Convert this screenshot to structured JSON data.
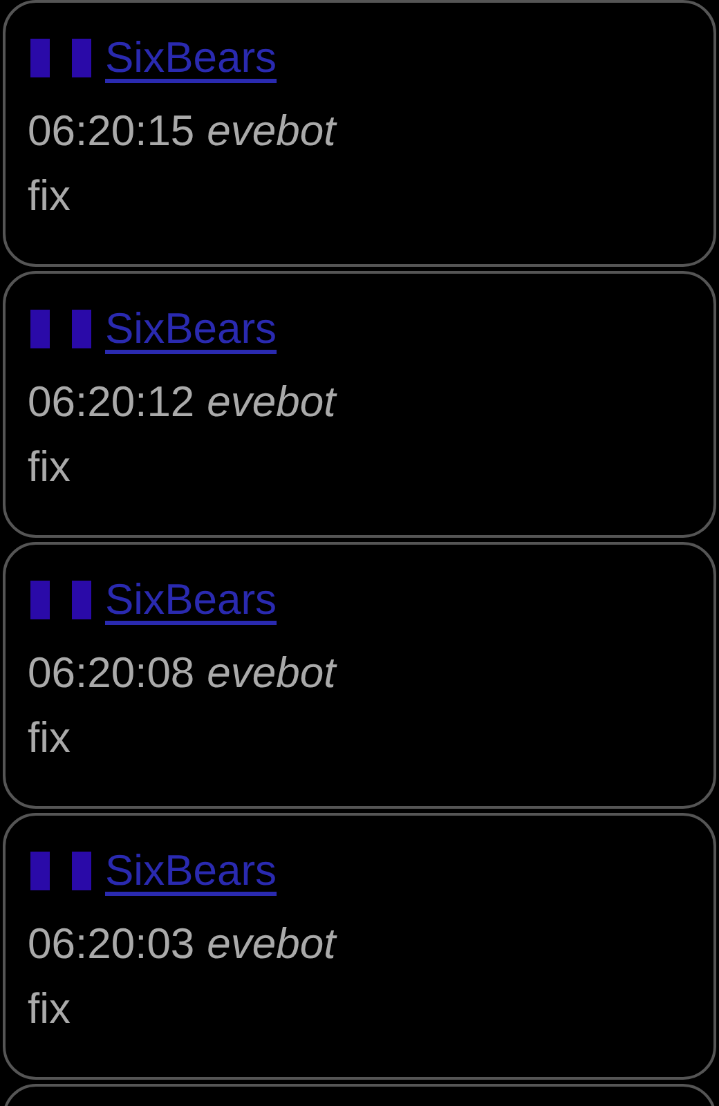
{
  "messages": [
    {
      "author": "SixBears",
      "time": "06:20:15",
      "bot": "evebot",
      "text": "fix"
    },
    {
      "author": "SixBears",
      "time": "06:20:12",
      "bot": "evebot",
      "text": "fix"
    },
    {
      "author": "SixBears",
      "time": "06:20:08",
      "bot": "evebot",
      "text": "fix"
    },
    {
      "author": "SixBears",
      "time": "06:20:03",
      "bot": "evebot",
      "text": "fix"
    }
  ]
}
